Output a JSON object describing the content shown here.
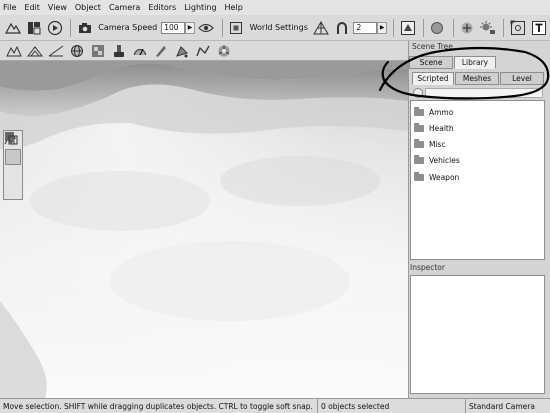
{
  "menubar": {
    "items": [
      "File",
      "Edit",
      "View",
      "Object",
      "Camera",
      "Editors",
      "Lighting",
      "Help"
    ]
  },
  "toolbar": {
    "camera_speed_label": "Camera Speed",
    "camera_speed_value": "100",
    "world_settings_label": "World Settings",
    "snap_value": "2"
  },
  "scene_tree": {
    "title": "Scene Tree",
    "tabs": [
      "Scene",
      "Library"
    ],
    "active_tab": "Library",
    "subtabs": [
      "Scripted",
      "Meshes",
      "Level"
    ],
    "active_subtab": "Scripted",
    "items": [
      "Ammo",
      "Health",
      "Misc",
      "Vehicles",
      "Weapon"
    ]
  },
  "inspector": {
    "title": "Inspector"
  },
  "statusbar": {
    "hint": "Move selection.  SHIFT while dragging duplicates objects.  CTRL to toggle soft snap.",
    "selection": "0 objects selected",
    "camera": "Standard Camera"
  },
  "icons": {
    "toolbar1": [
      "terrain-icon",
      "split-icon",
      "play-icon",
      "camera-icon",
      "eye-icon",
      "fit-icon",
      "wireframe-icon",
      "magnet-icon",
      "object-icon",
      "circle-icon",
      "add-icon",
      "light-icon",
      "center-icon",
      "text-icon"
    ],
    "toolbar2": [
      "terrain-raise-icon",
      "terrain-lower-icon",
      "terrain-smooth-icon",
      "globe-icon",
      "texture-icon",
      "brush-icon",
      "gauge-icon",
      "paint-icon",
      "fill-icon",
      "shape-icon",
      "sphere-icon"
    ],
    "viewport_tools": [
      "select-arrow-icon",
      "move-icon",
      "rotate-icon",
      "scale-icon"
    ]
  },
  "annotation_color": "#000000"
}
